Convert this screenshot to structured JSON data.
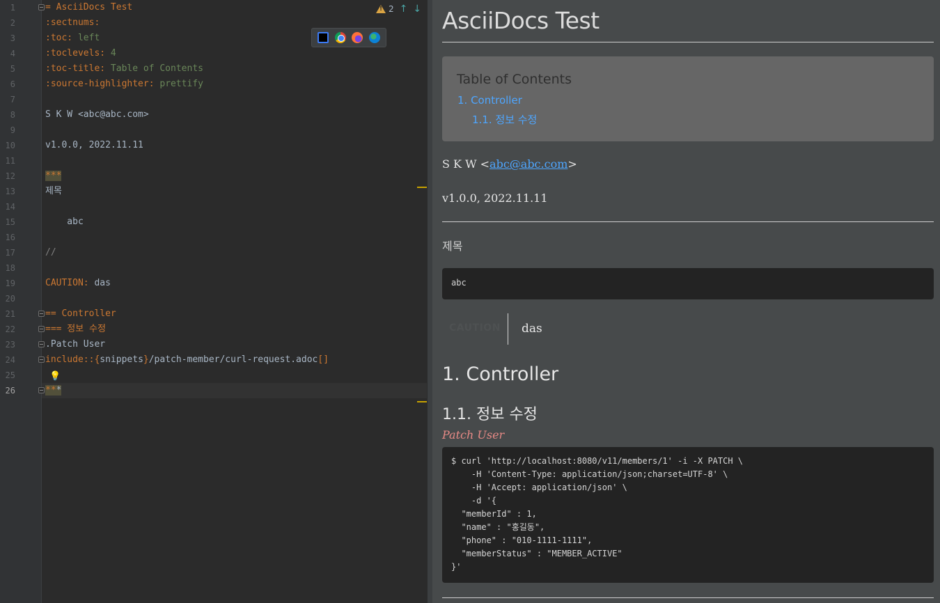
{
  "editor": {
    "line_numbers": [
      "1",
      "2",
      "3",
      "4",
      "5",
      "6",
      "7",
      "8",
      "9",
      "10",
      "11",
      "12",
      "13",
      "14",
      "15",
      "16",
      "17",
      "18",
      "19",
      "20",
      "21",
      "22",
      "23",
      "24",
      "25",
      "26"
    ],
    "l1": "= AsciiDocs Test",
    "l2": ":sectnums:",
    "l3_attr": ":toc:",
    "l3_val": " left",
    "l4_attr": ":toclevels:",
    "l4_val": " 4",
    "l5_attr": ":toc-title:",
    "l5_val": " Table of Contents",
    "l6_attr": ":source-highlighter:",
    "l6_val": " prettify",
    "l8": "S K W <abc@abc.com>",
    "l10": "v1.0.0, 2022.11.11",
    "l12": "***",
    "l13": "제목",
    "l15": "    abc",
    "l17": "//",
    "l19_label": "CAUTION:",
    "l19_text": " das",
    "l21": "== Controller",
    "l22": "=== 정보 수정",
    "l23": ".Patch User",
    "l24_macro": "include::",
    "l24_open": "{",
    "l24_attr": "snippets",
    "l24_close": "}",
    "l24_path": "/patch-member/curl-request.adoc",
    "l24_brackets": "[]",
    "l26_a": "**",
    "l26_b": "*",
    "warning_count": "2",
    "up_arrow": "↑",
    "down_arrow": "↓",
    "bulb_glyph": "💡"
  },
  "preview": {
    "title": "AsciiDocs Test",
    "toc_title": "Table of Contents",
    "toc_item_1": "1. Controller",
    "toc_item_1_1": "1.1. 정보 수정",
    "author_prefix": "S K W <",
    "author_email": "abc@abc.com",
    "author_suffix": ">",
    "revision": "v1.0.0, 2022.11.11",
    "section_title": "제목",
    "literal_block": "abc",
    "caution_label": "CAUTION",
    "caution_text": "das",
    "h2": "1. Controller",
    "h3": "1.1. 정보 수정",
    "block_title": "Patch User",
    "curl_code": "$ curl 'http://localhost:8080/v11/members/1' -i -X PATCH \\\n    -H 'Content-Type: application/json;charset=UTF-8' \\\n    -H 'Accept: application/json' \\\n    -d '{\n  \"memberId\" : 1,\n  \"name\" : \"홍길동\",\n  \"phone\" : \"010-1111-1111\",\n  \"memberStatus\" : \"MEMBER_ACTIVE\"\n}'"
  },
  "colors": {
    "editor_bg": "#2b2b2b",
    "keyword": "#cc7832",
    "string": "#6a8759",
    "number": "#6897bb",
    "preview_bg": "#474a4b",
    "link": "#4ea6ff",
    "block_title": "#e88a86"
  }
}
